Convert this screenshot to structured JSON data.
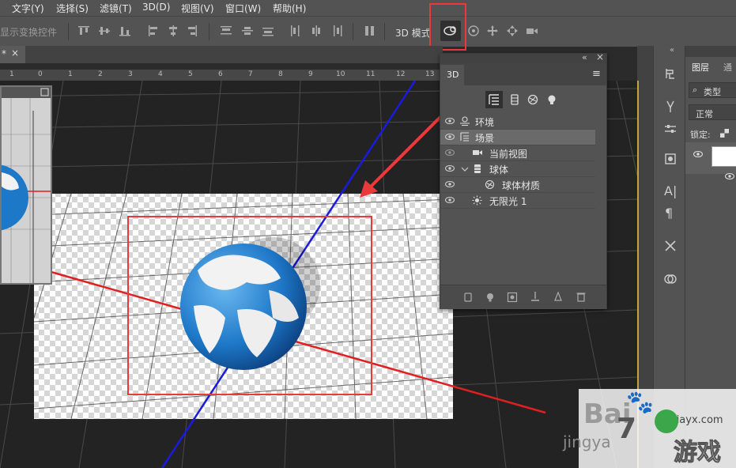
{
  "menubar": {
    "items": [
      "文字(Y)",
      "选择(S)",
      "滤镜(T)",
      "3D(D)",
      "视图(V)",
      "窗口(W)",
      "帮助(H)"
    ]
  },
  "optionsbar": {
    "show_transform_label": "显示变换控件",
    "mode_label": "3D 模式"
  },
  "doc_tab": {
    "label": "*",
    "close": "×"
  },
  "ruler": {
    "numbers": [
      "1",
      "0",
      "1",
      "2",
      "3",
      "4",
      "5",
      "6",
      "7",
      "8",
      "9",
      "10",
      "11",
      "12",
      "13"
    ]
  },
  "panel_3d": {
    "tab_label": "3D",
    "collapse_glyph": "«",
    "close_glyph": "×",
    "menu_glyph": "≡",
    "rows": [
      {
        "label": "环境"
      },
      {
        "label": "场景"
      },
      {
        "label": "当前视图"
      },
      {
        "label": "球体"
      },
      {
        "label": "球体材质"
      },
      {
        "label": "无限光 1"
      }
    ]
  },
  "layers_panel": {
    "tab_label": "图层",
    "tab2_label": "通",
    "search_placeholder": "类型",
    "blend_mode": "正常",
    "lock_label": "锁定:"
  },
  "watermark": {
    "text_top": "Bai",
    "text_jing": "jingya",
    "text_site": "xiayx.com",
    "text_game": "游戏",
    "text_num": "7"
  },
  "colors": {
    "axis_x": "#e02020",
    "axis_y": "#1a1ae0",
    "highlight": "#e83a3a",
    "panel_bg": "#535353"
  }
}
